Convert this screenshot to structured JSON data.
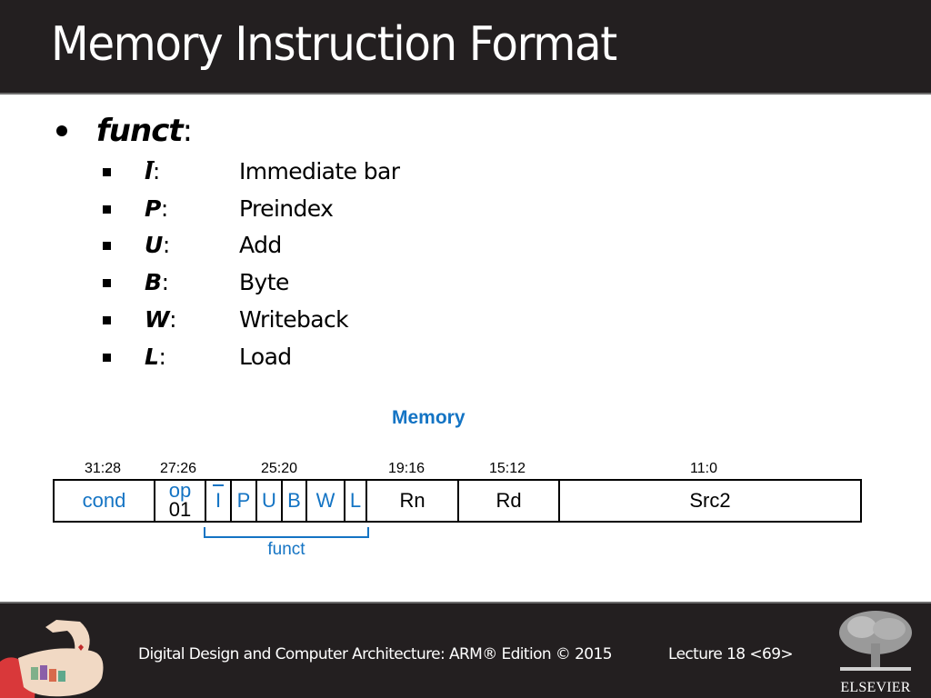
{
  "slide": {
    "title": "Memory Instruction Format"
  },
  "bullets": {
    "main": {
      "label": "funct",
      "colon": ":"
    },
    "items": [
      {
        "key": "I",
        "overbar": true,
        "colon": ":",
        "desc": "Immediate bar"
      },
      {
        "key": "P",
        "overbar": false,
        "colon": ":",
        "desc": "Preindex"
      },
      {
        "key": "U",
        "overbar": false,
        "colon": ":",
        "desc": "Add"
      },
      {
        "key": "B",
        "overbar": false,
        "colon": ":",
        "desc": "Byte"
      },
      {
        "key": "W",
        "overbar": false,
        "colon": ":",
        "desc": "Writeback"
      },
      {
        "key": "L",
        "overbar": false,
        "colon": ":",
        "desc": "Load"
      }
    ]
  },
  "diagram": {
    "title": "Memory",
    "bit_ranges": [
      "31:28",
      "27:26",
      "25:20",
      "19:16",
      "15:12",
      "11:0"
    ],
    "fields": {
      "cond": "cond",
      "op_name": "op",
      "op_value": "01",
      "funct_bits": [
        "I",
        "P",
        "U",
        "B",
        "W",
        "L"
      ],
      "rn": "Rn",
      "rd": "Rd",
      "src2": "Src2"
    },
    "funct_label": "funct",
    "colors": {
      "accent": "#1474c4",
      "text": "#000000"
    }
  },
  "footer": {
    "book": "Digital Design and Computer Architecture: ARM® Edition © 2015",
    "lecture": "Lecture 18 <69>",
    "publisher": "ELSEVIER"
  },
  "theme": {
    "header_bg": "#231f20",
    "footer_bg": "#231f20"
  }
}
